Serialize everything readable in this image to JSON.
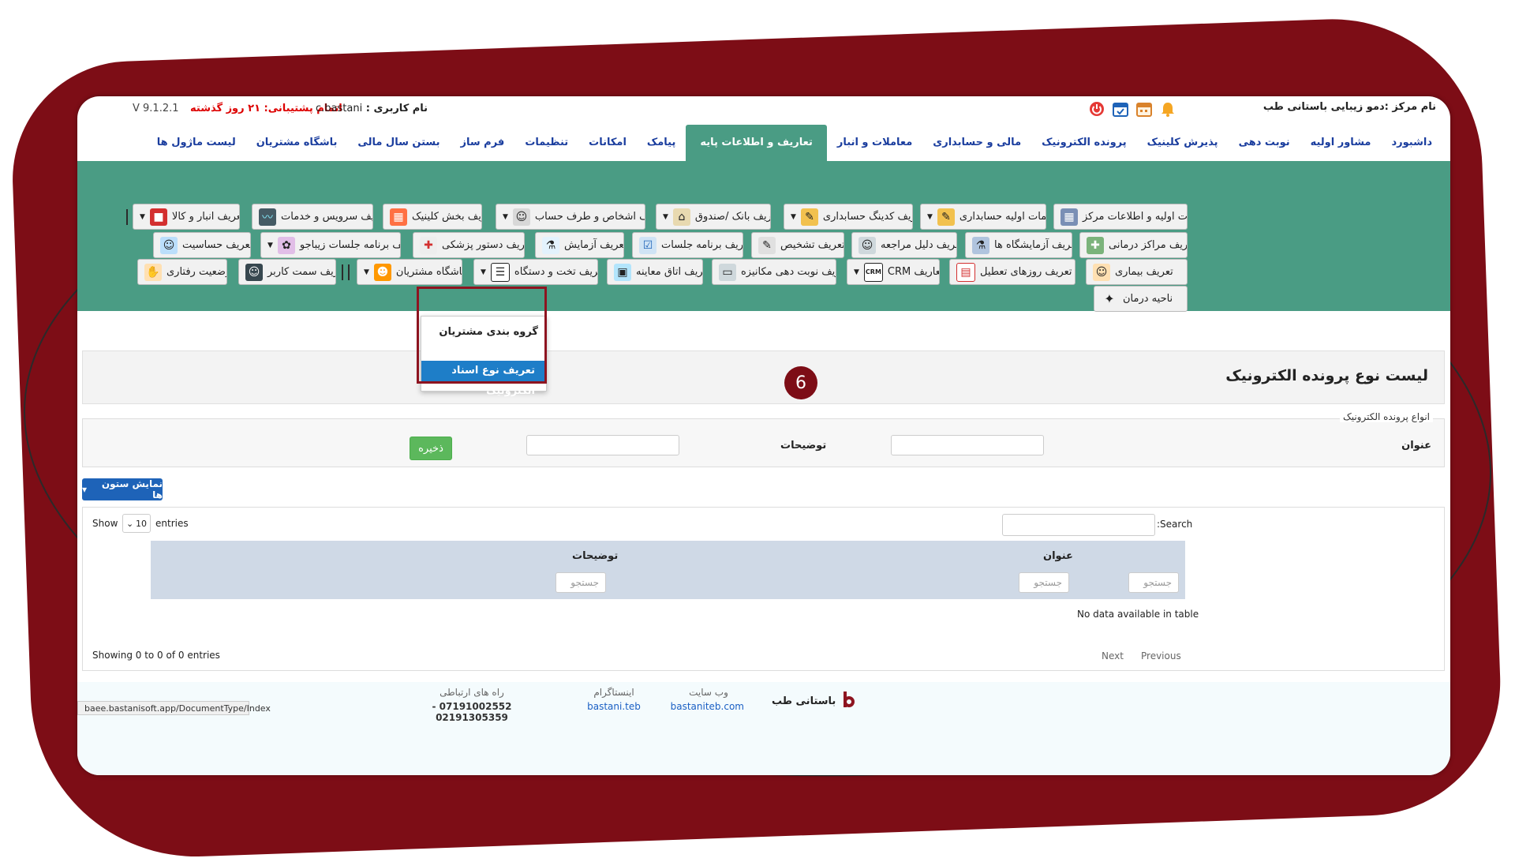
{
  "topbar": {
    "version": "V 9.1.2.1",
    "support": "اتمام پشتیبانی: ۲۱ روز گذشته",
    "user_label": "نام کاربری :",
    "user_value": "c.bastani",
    "center": "نام مرکز :دمو زیبایی باستانی طب"
  },
  "nav": [
    "داشبورد",
    "مشاور اولیه",
    "نوبت دهی",
    "پذیرش کلینیک",
    "پرونده الکترونیک",
    "مالی و حسابداری",
    "معاملات و انبار",
    "تعاریف و اطلاعات پایه",
    "پیامک",
    "امکانات",
    "تنظیمات",
    "فرم ساز",
    "بستن سال مالی",
    "باشگاه مشتریان",
    "لیست ماژول ها"
  ],
  "toolbar": {
    "row1": [
      "تنظیمات اولیه و اطلاعات مرکز",
      "تنظیمات اولیه حسابداری",
      "تعریف کدینگ حسابداری",
      "تعریف بانک /صندوق",
      "تعریف اشخاص و طرف حساب",
      "تعریف بخش کلینیک",
      "تعریف سرویس و خدمات",
      "تعریف انبار و کالا"
    ],
    "row2": [
      "تعریف مراکز درمانی",
      "تعریف آزمایشگاه ها",
      "تعریف دلیل مراجعه",
      "تعریف تشخیص",
      "تعریف برنامه جلسات",
      "تعریف آزمایش",
      "تعریف دستور پزشکی",
      "تعریف برنامه جلسات زیباجو",
      "تعریف حساسیت"
    ],
    "row3": [
      "تعریف بیماری",
      "تعریف روزهای تعطیل",
      "تعاریف CRM",
      "تعریف نوبت دهی مکانیزه",
      "تعریف اتاق معاینه",
      "تعریف تخت و دستگاه",
      "باشگاه مشتریان",
      "تعریف سمت کاربر",
      "وضعیت رفتاری"
    ],
    "row4": [
      "ناحیه درمان"
    ]
  },
  "dropdown": {
    "items": [
      "گروه بندی مشتریان",
      "تعریف نوع اسناد الکترونیک"
    ]
  },
  "step_number": "6",
  "page": {
    "title": "لیست نوع پرونده الکترونیک"
  },
  "form": {
    "legend": "انواع پرونده الکترونیک",
    "title_label": "عنوان",
    "desc_label": "توضیحات",
    "save_label": "ذخیره"
  },
  "table": {
    "columns_button": "نمایش ستون ها",
    "show_label": "Show",
    "length_value": "10",
    "entries_label": "entries",
    "search_label": "Search:",
    "headers": [
      "عنوان",
      "توضیحات"
    ],
    "filter_placeholder": "جستجو",
    "empty_text": "No data available in table",
    "info_text": "Showing 0 to 0 of 0 entries",
    "prev_label": "Previous",
    "next_label": "Next"
  },
  "footer": {
    "brand": "باستانی طب",
    "website_label": "وب سایت",
    "website_value": "bastaniteb.com",
    "instagram_label": "اینستاگرام",
    "instagram_value": "bastani.teb",
    "contact_label": "راه های ارتباطی",
    "contact_value": "07191002552 - 02191305359",
    "status_url": "baee.bastanisoft.app/DocumentType/Index"
  },
  "colors": {
    "frame": "#7d0d16",
    "toolbar": "#4a9c84",
    "nav_text": "#1a3d9e",
    "primary": "#1e63b8",
    "save": "#5cb85c"
  }
}
